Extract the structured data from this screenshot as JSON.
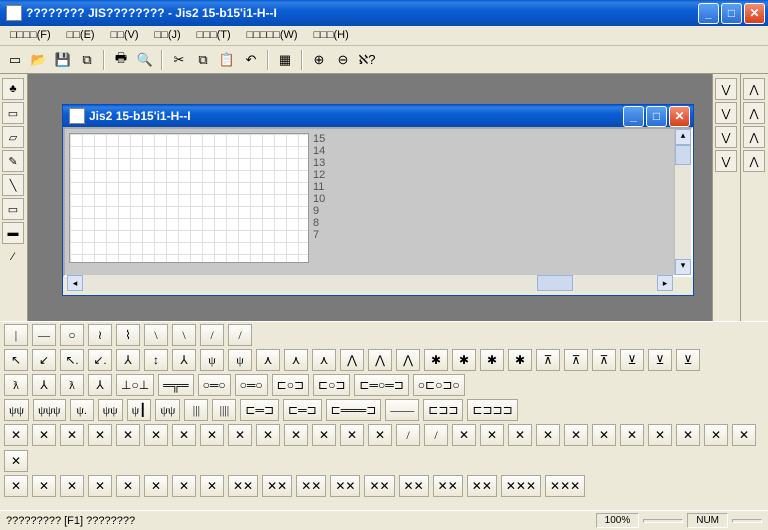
{
  "app": {
    "title": "???????? JIS???????? - Jis2 15-b15'i1-H--I"
  },
  "menu": [
    "□□□□(F)",
    "□□(E)",
    "□□(V)",
    "□□(J)",
    "□□□(T)",
    "□□□□□(W)",
    "□□□(H)"
  ],
  "toolbar_icons": [
    "new",
    "open",
    "save",
    "save-all",
    "|",
    "print",
    "preview",
    "|",
    "cut",
    "copy",
    "paste",
    "undo",
    "|",
    "grid",
    "|",
    "zoom-in",
    "zoom-out",
    "help"
  ],
  "left_tools": [
    "stamp",
    "select",
    "eraser",
    "pencil",
    "line",
    "rect",
    "fill",
    "eyedrop"
  ],
  "right_tools": [
    "glyph-a",
    "glyph-b",
    "glyph-c",
    "glyph-d",
    "glyph-e",
    "glyph-f"
  ],
  "mdi": {
    "title": "Jis2 15-b15'i1-H--I",
    "rows": [
      "15",
      "14",
      "13",
      "12",
      "11",
      "10",
      "9",
      "8",
      "7"
    ]
  },
  "palettes": {
    "r1": [
      "|",
      "—",
      "○",
      "≀",
      "⌇",
      "\\",
      "\\",
      "/",
      "/"
    ],
    "r2": [
      "↖",
      "↙",
      "↖.",
      "↙.",
      "⅄",
      "↕",
      "⅄",
      "ψ",
      "ψ",
      "⋏",
      "⋏",
      "⋏",
      "⋀",
      "⋀",
      "⋀",
      "✱",
      "✱",
      "✱",
      "✱",
      "⊼",
      "⊼",
      "⊼",
      "⊻",
      "⊻",
      "⊻"
    ],
    "r3": [
      "ƛ",
      "⅄",
      "ƛ",
      "⅄",
      "⊥○⊥",
      "═╦═",
      "○═○",
      "○═○",
      "⊏○⊐",
      "⊏○⊐",
      "⊏═○═⊐",
      "○⊏○⊐○"
    ],
    "r4": [
      "ψψ",
      "ψψψ",
      "ψ.",
      "ψψ",
      "ψ┃",
      "ψψ",
      "|||",
      "||||",
      "⊏═⊐",
      "⊏═⊐",
      "⊏═══⊐",
      "――",
      "⊏⊐⊐",
      "⊏⊐⊐⊐"
    ],
    "r5": [
      "✕",
      "✕",
      "✕",
      "✕",
      "✕",
      "✕",
      "✕",
      "✕",
      "✕",
      "✕",
      "✕",
      "✕",
      "✕",
      "✕",
      "/",
      "/",
      "✕",
      "✕",
      "✕",
      "✕",
      "✕",
      "✕",
      "✕",
      "✕",
      "✕",
      "✕",
      "✕",
      "✕"
    ],
    "r6": [
      "✕",
      "✕",
      "✕",
      "✕",
      "✕",
      "✕",
      "✕",
      "✕",
      "✕✕",
      "✕✕",
      "✕✕",
      "✕✕",
      "✕✕",
      "✕✕",
      "✕✕",
      "✕✕",
      "✕✕✕",
      "✕✕✕"
    ]
  },
  "status": {
    "left": "????????? [F1] ????????",
    "zoom": "100%",
    "num": "NUM"
  }
}
